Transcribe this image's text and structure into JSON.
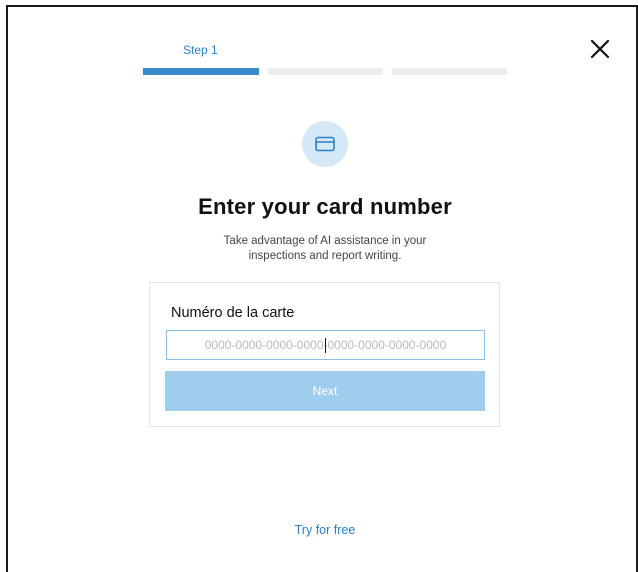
{
  "stepper": {
    "step_label": "Step 1",
    "active_step": 1,
    "total_steps": 3
  },
  "header": {
    "close_icon": "close-icon"
  },
  "hero": {
    "icon": "credit-card-icon",
    "title": "Enter your card number",
    "subtitle": "Take advantage of AI assistance in your inspections and report writing."
  },
  "form": {
    "field_label": "Numéro de la carte",
    "card_input": {
      "value": "",
      "placeholder": "0000-0000-0000-0000-0000-0000-0000-0000"
    },
    "next_label": "Next"
  },
  "footer": {
    "try_free_label": "Try for free"
  },
  "colors": {
    "accent": "#3a8ccb",
    "link": "#2b7fc4",
    "button_disabled": "#9fcdee",
    "progress_inactive": "#e9eeee",
    "icon_circle": "#d4e8f7"
  }
}
